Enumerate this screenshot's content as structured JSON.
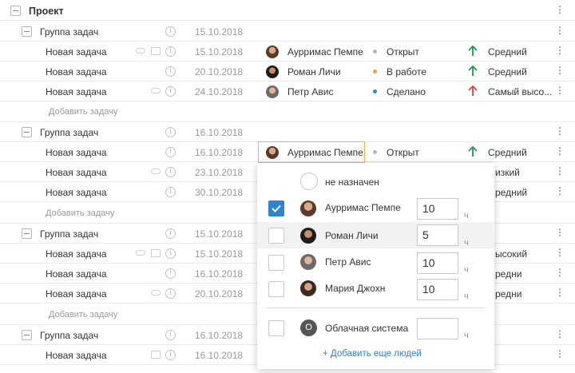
{
  "project": {
    "title": "Проект"
  },
  "groups": [
    {
      "title": "Группа задач",
      "date": "15.10.2018",
      "tasks": [
        {
          "name": "Новая задача",
          "date": "15.10.2018",
          "assignee": "Аурримас Пемпе",
          "status": "Открыт",
          "priority": "Средний"
        },
        {
          "name": "Новая задача",
          "date": "20.10.2018",
          "assignee": "Роман Личи",
          "status": "В работе",
          "priority": "Средний"
        },
        {
          "name": "Новая задача",
          "date": "24.10.2018",
          "assignee": "Петр Авис",
          "status": "Сделано",
          "priority": "Самый высо..."
        }
      ],
      "add_label": "Добавить задачу"
    },
    {
      "title": "Группа задач",
      "date": "16.10.2018",
      "tasks": [
        {
          "name": "Новая задача",
          "date": "16.10.2018",
          "assignee": "Аурримас Пемпе",
          "status": "Открыт",
          "priority": "Средний"
        },
        {
          "name": "Новая задача",
          "date": "23.10.2018",
          "priority": "изкий"
        },
        {
          "name": "Новая задача",
          "date": "30.10.2018",
          "priority": "редний"
        }
      ],
      "add_label": "Добавить задачу"
    },
    {
      "title": "Группа задач",
      "date": "15.10.2018",
      "tasks": [
        {
          "name": "Новая задача",
          "date": "15.10.2018",
          "priority": "ысокий"
        },
        {
          "name": "Новая задача",
          "date": "16.10.2018",
          "priority": "редни"
        },
        {
          "name": "Новая задача",
          "date": "20.10.2018",
          "priority": "редни"
        }
      ],
      "add_label": "Добавить задачу"
    },
    {
      "title": "Группа задач",
      "date": "16.10.2018",
      "tasks": [
        {
          "name": "Новая задача",
          "date": "16.10.2018"
        }
      ]
    }
  ],
  "popup": {
    "unassigned": "не назначен",
    "people": [
      {
        "name": "Аурримас Пемпе",
        "hours": "10",
        "checked": true
      },
      {
        "name": "Роман Личи",
        "hours": "5",
        "checked": false
      },
      {
        "name": "Петр Авис",
        "hours": "10",
        "checked": false
      },
      {
        "name": "Мария Джохн",
        "hours": "10",
        "checked": false
      }
    ],
    "system": {
      "initial": "О",
      "name": "Облачная система",
      "hours": ""
    },
    "hours_unit": "ч",
    "add_people": "+ Добавить еще людей"
  },
  "colors": {
    "open": "#b5b5b5",
    "in_progress": "#f5a623",
    "done": "#3a86d4",
    "priority_mid": "#1f9a4a",
    "priority_high": "#e0453c",
    "accent": "#2f83cf",
    "selection": "#f5b54a"
  },
  "icons": {
    "kebab": "⋮",
    "info": "i",
    "check": "✓"
  }
}
